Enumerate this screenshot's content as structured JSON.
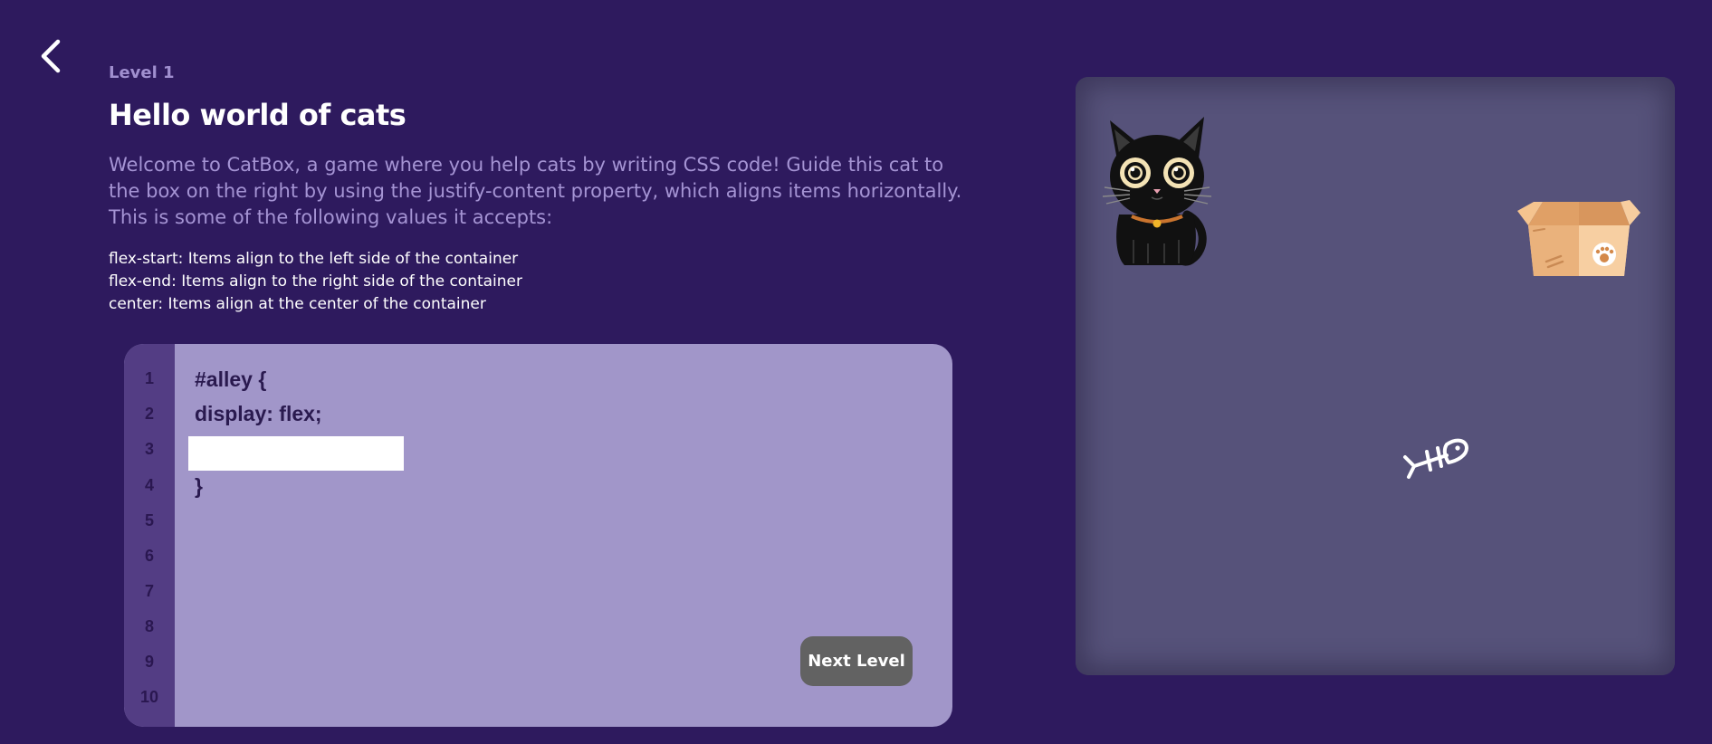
{
  "app": {
    "level_label": "Level 1",
    "title": "Hello world of cats",
    "intro": "Welcome to CatBox, a game where you help cats by writing CSS code! Guide this cat to the box on the right by using the justify-content property, which aligns items horizontally. This is some of the following values it accepts:",
    "values": [
      "flex-start: Items align to the left side of the container",
      "flex-end: Items align to the right side of the container",
      "center: Items align at the center of the container"
    ]
  },
  "editor": {
    "line_numbers": [
      "1",
      "2",
      "3",
      "4",
      "5",
      "6",
      "7",
      "8",
      "9",
      "10"
    ],
    "code": {
      "line1": "#alley {",
      "line2": "display: flex;",
      "line4": "}"
    },
    "input_value": "",
    "next_label": "Next Level"
  },
  "icons": {
    "back": "chevron-left-icon",
    "cat": "black-cat-icon",
    "box": "cardboard-box-icon",
    "fish": "fish-bone-icon"
  },
  "colors": {
    "background": "#2e1a5e",
    "editor_bg": "#a196c9",
    "gutter_bg": "#533d84",
    "board_bg": "#56527a",
    "button_bg": "#626262"
  }
}
